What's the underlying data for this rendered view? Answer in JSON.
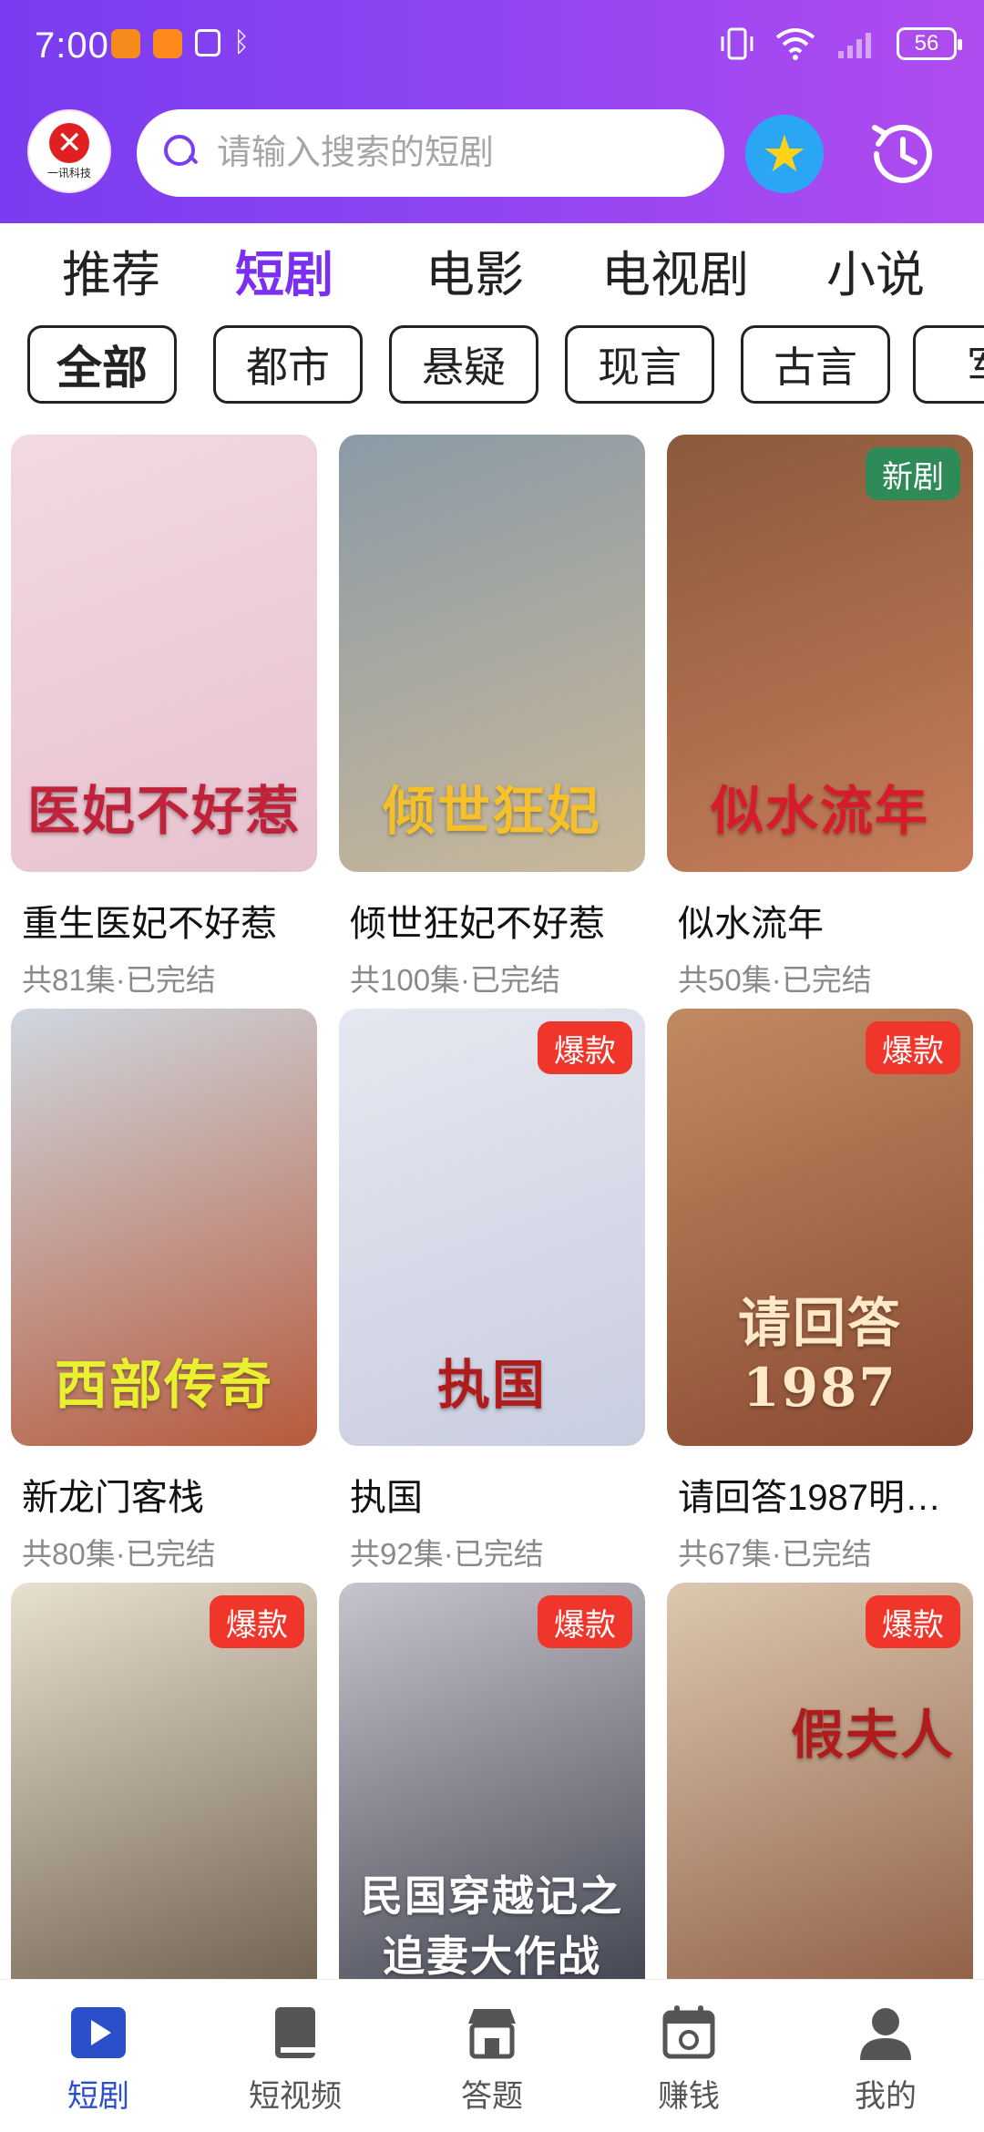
{
  "status_bar": {
    "time": "7:00",
    "battery": "56"
  },
  "header": {
    "logo_text": "一讯科技",
    "search": {
      "placeholder": "请输入搜索的短剧"
    },
    "favorites_icon": "star-icon",
    "history_icon": "clock-history-icon"
  },
  "tabs": [
    {
      "label": "推荐",
      "active": false
    },
    {
      "label": "短剧",
      "active": true
    },
    {
      "label": "电影",
      "active": false
    },
    {
      "label": "电视剧",
      "active": false
    },
    {
      "label": "小说",
      "active": false
    }
  ],
  "categories": [
    {
      "label": "全部",
      "active": true
    },
    {
      "label": "都市",
      "active": false
    },
    {
      "label": "悬疑",
      "active": false
    },
    {
      "label": "现言",
      "active": false
    },
    {
      "label": "古言",
      "active": false
    },
    {
      "label": "军",
      "active": false
    }
  ],
  "dramas": [
    {
      "name": "重生医妃不好惹",
      "meta": "共81集·已完结",
      "badge": "",
      "poster_text": "医妃不好惹",
      "poster_colors": [
        "#f2d9e2",
        "#e7c2cf"
      ],
      "text_color": "#c0223a"
    },
    {
      "name": "倾世狂妃不好惹",
      "meta": "共100集·已完结",
      "badge": "",
      "poster_text": "倾世狂妃",
      "poster_colors": [
        "#8a9aa6",
        "#c9b89a"
      ],
      "text_color": "#f5c02a"
    },
    {
      "name": "似水流年",
      "meta": "共50集·已完结",
      "badge": "新剧",
      "poster_text": "似水流年",
      "poster_colors": [
        "#8a5a3c",
        "#c77d5a"
      ],
      "text_color": "#d81b2a"
    },
    {
      "name": "新龙门客栈",
      "meta": "共80集·已完结",
      "badge": "",
      "poster_text": "西部传奇",
      "poster_colors": [
        "#cfd8e0",
        "#b65a3c"
      ],
      "text_color": "#e8f030"
    },
    {
      "name": "执国",
      "meta": "共92集·已完结",
      "badge": "爆款",
      "poster_text": "执国",
      "poster_colors": [
        "#e6e8f0",
        "#c8cde0"
      ],
      "text_color": "#b01c1c"
    },
    {
      "name": "请回答1987明…",
      "meta": "共67集·已完结",
      "badge": "爆款",
      "poster_text": "请回答1987",
      "poster_colors": [
        "#c08a62",
        "#8a4a32"
      ],
      "text_color": "#ffe9c8"
    },
    {
      "name": "",
      "meta": "",
      "badge": "爆款",
      "poster_text": "",
      "poster_colors": [
        "#e8e0d0",
        "#6a5a48"
      ],
      "text_color": "#7a1a1a"
    },
    {
      "name": "",
      "meta": "",
      "badge": "爆款",
      "poster_text": "民国穿越记之追妻大作战",
      "poster_colors": [
        "#c8c4cc",
        "#3a3e4a"
      ],
      "text_color": "#ffffff"
    },
    {
      "name": "",
      "meta": "",
      "badge": "爆款",
      "poster_text": "假夫人",
      "poster_colors": [
        "#dcc8b0",
        "#8c5a40"
      ],
      "text_color": "#b01c1c"
    }
  ],
  "bottom_nav": [
    {
      "label": "短剧",
      "icon": "play-icon",
      "active": true
    },
    {
      "label": "短视频",
      "icon": "book-icon",
      "active": false
    },
    {
      "label": "答题",
      "icon": "store-icon",
      "active": false
    },
    {
      "label": "赚钱",
      "icon": "calendar-icon",
      "active": false
    },
    {
      "label": "我的",
      "icon": "user-icon",
      "active": false
    }
  ],
  "colors": {
    "accent": "#7b2ff0",
    "badge_new": "#2e8b57",
    "badge_hot": "#f0362b",
    "nav_active": "#2b4fc9"
  }
}
